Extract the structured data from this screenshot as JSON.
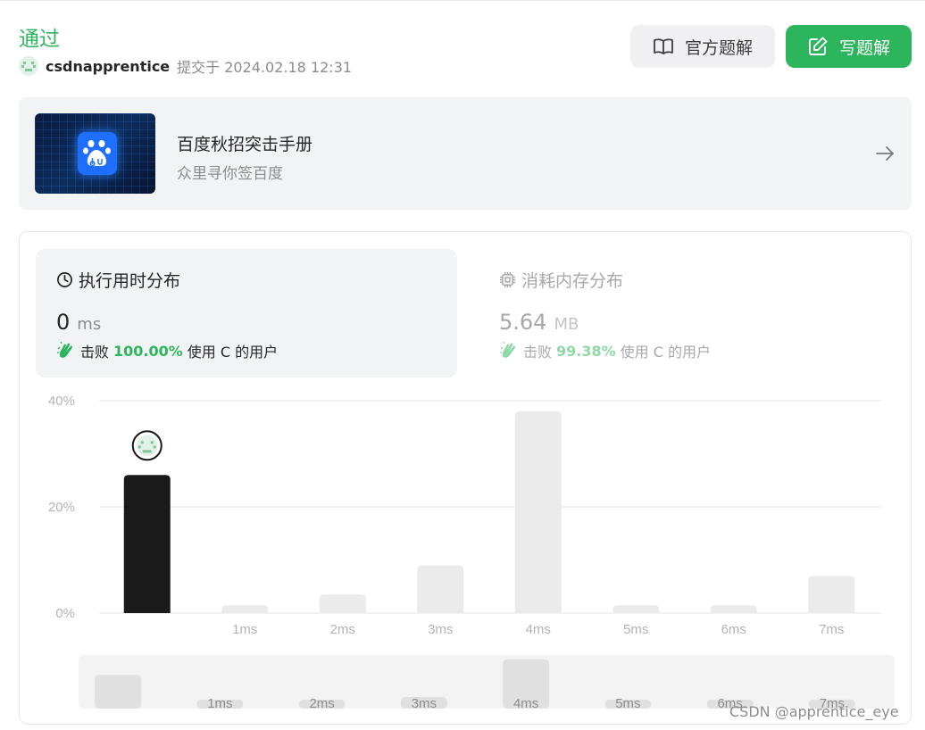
{
  "header": {
    "status": "通过",
    "username": "csdnapprentice",
    "submitted": "提交于 2024.02.18 12:31"
  },
  "buttons": {
    "solution_label": "官方题解",
    "write_label": "写题解"
  },
  "banner": {
    "title": "百度秋招突击手册",
    "subtitle": "众里寻你签百度"
  },
  "stats": {
    "runtime": {
      "title": "执行用时分布",
      "value": "0",
      "unit": "ms",
      "beat_prefix": "击败",
      "beat_percent": "100.00%",
      "beat_suffix": "使用 C 的用户"
    },
    "memory": {
      "title": "消耗内存分布",
      "value": "5.64",
      "unit": "MB",
      "beat_prefix": "击败",
      "beat_percent": "99.38%",
      "beat_suffix": "使用 C 的用户"
    }
  },
  "chart_data": {
    "type": "bar",
    "categories": [
      "",
      "1ms",
      "2ms",
      "3ms",
      "4ms",
      "5ms",
      "6ms",
      "7ms"
    ],
    "values": [
      26,
      1.5,
      3.5,
      9,
      38,
      1.5,
      1.5,
      7
    ],
    "y_ticks": [
      "0%",
      "20%",
      "40%"
    ],
    "ylim": [
      0,
      40
    ],
    "highlight_index": 0,
    "highlight_color": "#1a1a1a",
    "bar_color": "#ebebeb",
    "minimap_categories": [
      "",
      "1ms",
      "2ms",
      "3ms",
      "4ms",
      "5ms",
      "6ms",
      "7ms"
    ]
  },
  "watermark": "CSDN @apprentice_eye"
}
